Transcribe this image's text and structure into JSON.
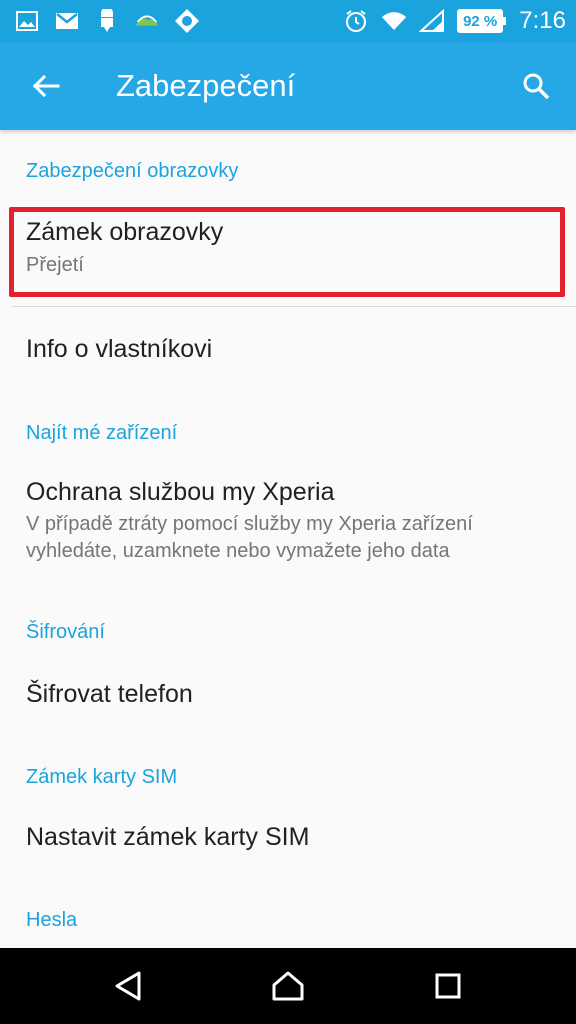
{
  "status_bar": {
    "notifications": [
      "gallery-icon",
      "gmail-icon",
      "android-download-icon",
      "weather-icon",
      "app-icon"
    ],
    "alarm_icon": "alarm-icon",
    "wifi_icon": "wifi-icon",
    "signal_icon": "signal-icon",
    "battery_percent": "92 %",
    "time": "7:16"
  },
  "app_bar": {
    "title": "Zabezpečení",
    "back_icon": "arrow-back-icon",
    "search_icon": "search-icon",
    "color": "#27a8e6"
  },
  "sections": [
    {
      "header": "Zabezpečení obrazovky",
      "items": [
        {
          "title": "Zámek obrazovky",
          "subtitle": "Přejetí",
          "highlighted": true
        },
        {
          "title": "Info o vlastníkovi"
        }
      ]
    },
    {
      "header": "Najít mé zařízení",
      "items": [
        {
          "title": "Ochrana službou my Xperia",
          "subtitle": "V případě ztráty pomocí služby my Xperia zařízení vyhledáte, uzamknete nebo vymažete jeho data"
        }
      ]
    },
    {
      "header": "Šifrování",
      "items": [
        {
          "title": "Šifrovat telefon"
        }
      ]
    },
    {
      "header": "Zámek karty SIM",
      "items": [
        {
          "title": "Nastavit zámek karty SIM"
        }
      ]
    },
    {
      "header": "Hesla",
      "items": []
    }
  ],
  "nav_bar": {
    "back": "nav-back-icon",
    "home": "nav-home-icon",
    "recents": "nav-recents-icon"
  },
  "colors": {
    "accent": "#1ba3de",
    "highlight": "#e3202e"
  }
}
